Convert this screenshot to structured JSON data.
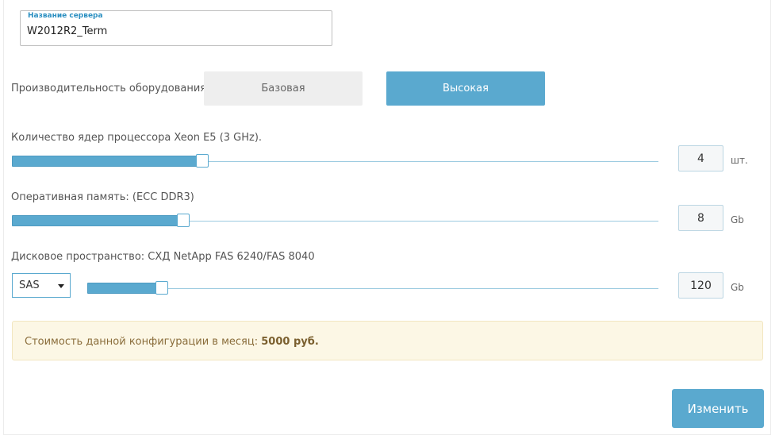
{
  "server_name": {
    "label": "Название сервера",
    "value": "W2012R2_Term"
  },
  "performance": {
    "label": "Производительность оборудования",
    "options": [
      "Базовая",
      "Высокая"
    ],
    "selected": "Высокая"
  },
  "cpu": {
    "label": "Количество ядер процессора Xeon E5 (3 GHz).",
    "value": "4",
    "unit": "шт.",
    "slider_level": 0.29
  },
  "ram": {
    "label": "Оперативная память: (ECC DDR3)",
    "value": "8",
    "unit": "Gb",
    "slider_level": 0.26
  },
  "disk": {
    "label": "Дисковое пространство: СХД NetApp FAS 6240/FAS 8040",
    "type": "SAS",
    "value": "120",
    "unit": "Gb",
    "slider_level": 0.13
  },
  "price": {
    "text": "Стоимость данной конфигурации в месяц:",
    "amount": "5000 руб."
  },
  "submit_label": "Изменить",
  "colors": {
    "accent": "#5aa9cf",
    "price_bg": "#fcf7e5",
    "price_text": "#8a6d3b"
  }
}
